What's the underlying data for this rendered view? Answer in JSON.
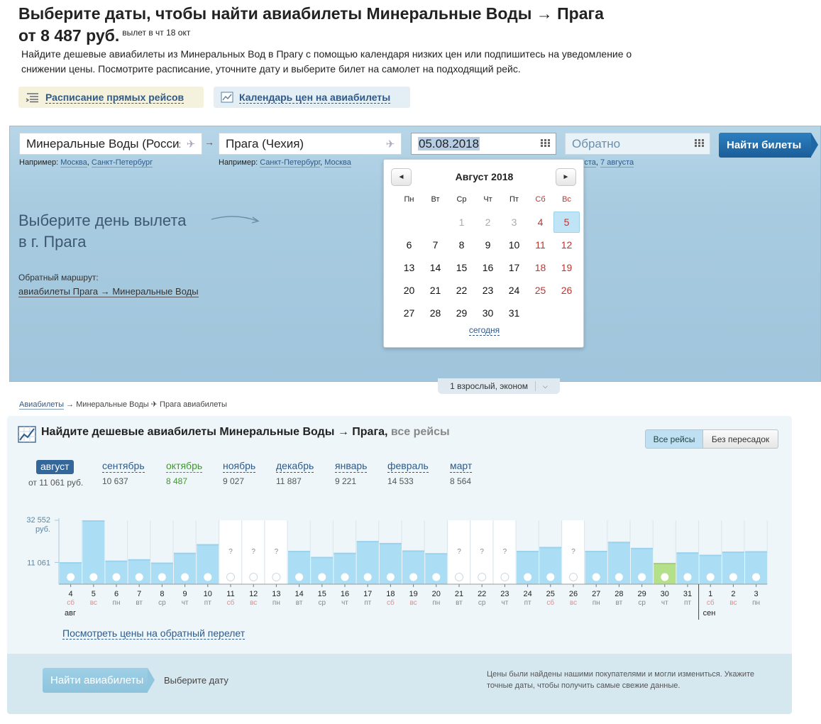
{
  "header": {
    "title": "Выберите даты, чтобы найти авиабилеты Минеральные Воды → Прага",
    "price": "от 8 487 руб.",
    "price_note": "вылет в чт 18 окт",
    "intro": "Найдите дешевые авиабилеты из Минеральных Вод в Прагу с помощью календаря низких цен или подпишитесь на уведомление о снижении цены. Посмотрите расписание, уточните дату и выберите билет на самолет на подходящий рейс.",
    "schedule_link": "Расписание прямых рейсов",
    "calendar_link": "Календарь цен на авиабилеты"
  },
  "search": {
    "from_value": "Минеральные Воды (Россия)",
    "to_value": "Прага (Чехия)",
    "depart_value": "05.08.2018",
    "return_placeholder": "Обратно",
    "find_button": "Найти билеты",
    "hint_prefix": "Например:",
    "from_hints": [
      "Москва",
      "Санкт-Петербург"
    ],
    "to_hints": [
      "Санкт-Петербург",
      "Москва"
    ],
    "return_hints_partial": [
      "уста",
      "7 августа"
    ],
    "choose_day_line1": "Выберите день вылета",
    "choose_day_line2": "в г. Прага",
    "back_route_title": "Обратный маршрут:",
    "back_route_link": "авиабилеты Прага → Минеральные Воды",
    "passengers": "1 взрослый, эконом"
  },
  "calendar": {
    "title": "Август 2018",
    "weekdays": [
      "Пн",
      "Вт",
      "Ср",
      "Чт",
      "Пт",
      "Сб",
      "Вс"
    ],
    "leading_blanks": 2,
    "past_days": [
      1,
      2,
      3
    ],
    "selected_day": 5,
    "days_in_month": 31,
    "today_link": "сегодня"
  },
  "breadcrumbs": {
    "root": "Авиабилеты",
    "sep": "→",
    "rest": "Минеральные Воды ✈ Прага авиабилеты"
  },
  "prices": {
    "title": "Найдите дешевые авиабилеты Минеральные Воды → Прага,",
    "title_suffix": "все рейсы",
    "filter_all": "Все рейсы",
    "filter_direct": "Без пересадок",
    "months": [
      {
        "name": "август",
        "price": "от 11 061 руб.",
        "active": true
      },
      {
        "name": "сентябрь",
        "price": "10 637"
      },
      {
        "name": "октябрь",
        "price": "8 487",
        "cheapest": true
      },
      {
        "name": "ноябрь",
        "price": "9 027"
      },
      {
        "name": "декабрь",
        "price": "11 887"
      },
      {
        "name": "январь",
        "price": "9 221"
      },
      {
        "name": "февраль",
        "price": "14 533"
      },
      {
        "name": "март",
        "price": "8 564"
      }
    ],
    "reverse_link": "Посмотреть цены на обратный перелет",
    "find_button": "Найти авиабилеты",
    "choose_date": "Выберите дату",
    "note": "Цены были найдены нашими покупателями и могли измениться. Укажите точные даты, чтобы получить самые свежие данные."
  },
  "chart_data": {
    "type": "bar",
    "y_ticks": [
      {
        "value": 32552,
        "label": "32 552",
        "unit": "руб."
      },
      {
        "value": 11061,
        "label": "11 061"
      }
    ],
    "ylim": [
      0,
      32552
    ],
    "x": [
      {
        "day": "4",
        "wd": "сб",
        "value": 11200,
        "we": true
      },
      {
        "day": "5",
        "wd": "вс",
        "value": 32552,
        "we": true
      },
      {
        "day": "6",
        "wd": "пн",
        "value": 12000
      },
      {
        "day": "7",
        "wd": "вт",
        "value": 12700
      },
      {
        "day": "8",
        "wd": "ср",
        "value": 11000
      },
      {
        "day": "9",
        "wd": "чт",
        "value": 16000
      },
      {
        "day": "10",
        "wd": "пт",
        "value": 20400
      },
      {
        "day": "11",
        "wd": "сб",
        "value": null,
        "we": true
      },
      {
        "day": "12",
        "wd": "вс",
        "value": null,
        "we": true
      },
      {
        "day": "13",
        "wd": "пн",
        "value": null
      },
      {
        "day": "14",
        "wd": "вт",
        "value": 17000
      },
      {
        "day": "15",
        "wd": "ср",
        "value": 13900
      },
      {
        "day": "16",
        "wd": "чт",
        "value": 16000
      },
      {
        "day": "17",
        "wd": "пт",
        "value": 22000
      },
      {
        "day": "18",
        "wd": "сб",
        "value": 21000,
        "we": true
      },
      {
        "day": "19",
        "wd": "вс",
        "value": 17200,
        "we": true
      },
      {
        "day": "20",
        "wd": "пн",
        "value": 15800
      },
      {
        "day": "21",
        "wd": "вт",
        "value": null
      },
      {
        "day": "22",
        "wd": "ср",
        "value": null
      },
      {
        "day": "23",
        "wd": "чт",
        "value": null
      },
      {
        "day": "24",
        "wd": "пт",
        "value": 17000
      },
      {
        "day": "25",
        "wd": "сб",
        "value": 19000,
        "we": true
      },
      {
        "day": "26",
        "wd": "вс",
        "value": null,
        "we": true
      },
      {
        "day": "27",
        "wd": "пн",
        "value": 17000
      },
      {
        "day": "28",
        "wd": "вт",
        "value": 21600
      },
      {
        "day": "29",
        "wd": "ср",
        "value": 18500
      },
      {
        "day": "30",
        "wd": "чт",
        "value": 10800,
        "cheapest": true
      },
      {
        "day": "31",
        "wd": "пт",
        "value": 16200
      },
      {
        "day": "1",
        "wd": "сб",
        "value": 15000,
        "we": true
      },
      {
        "day": "2",
        "wd": "вс",
        "value": 16600,
        "we": true
      },
      {
        "day": "3",
        "wd": "пн",
        "value": 16800
      }
    ],
    "month_labels": [
      {
        "index": 0,
        "label": "авг"
      },
      {
        "index": 28,
        "label": "сен"
      }
    ],
    "unknown_marker": "?",
    "colors": {
      "bar": "#abdef4",
      "bar_top": "#9bd2ee",
      "cheapest": "#b5e08a",
      "empty": "#ffffff"
    }
  }
}
